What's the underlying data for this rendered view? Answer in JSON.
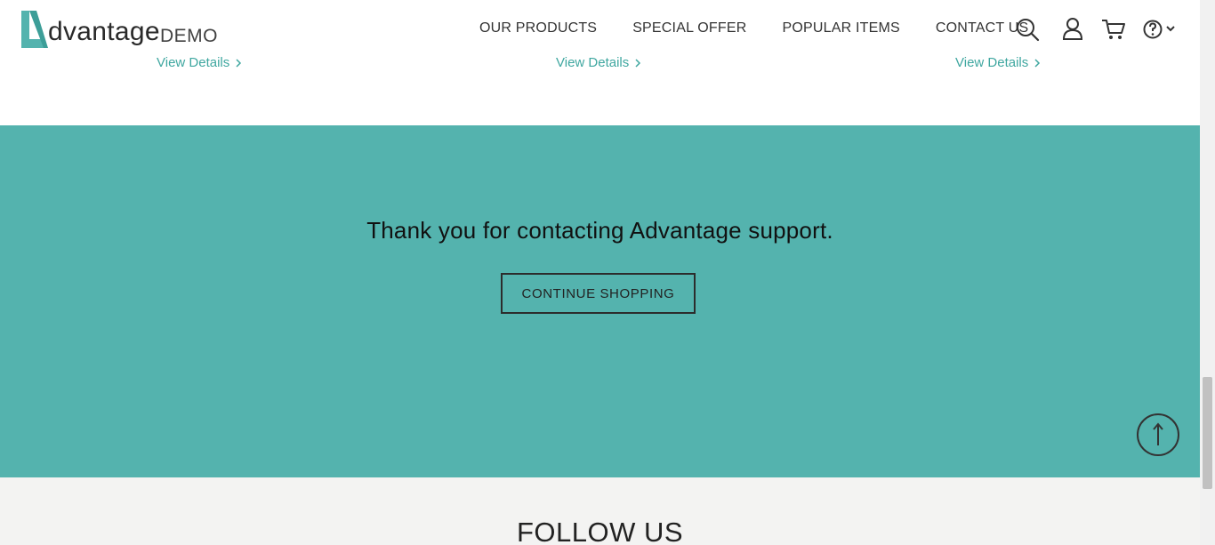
{
  "header": {
    "logo_text": "dvantage",
    "logo_demo": "DEMO",
    "nav": [
      "OUR PRODUCTS",
      "SPECIAL OFFER",
      "POPULAR ITEMS",
      "CONTACT US"
    ],
    "icons": [
      "search-icon",
      "user-icon",
      "cart-icon",
      "help-icon",
      "chevron-down-icon"
    ]
  },
  "product_links": [
    "View Details",
    "View Details",
    "View Details"
  ],
  "confirmation": {
    "message": "Thank you for contacting Advantage support.",
    "button_label": "CONTINUE SHOPPING"
  },
  "follow": {
    "title": "FOLLOW US"
  },
  "colors": {
    "accent": "#54b3ae",
    "link": "#3fa7a0",
    "follow_bg": "#f3f3f2"
  }
}
